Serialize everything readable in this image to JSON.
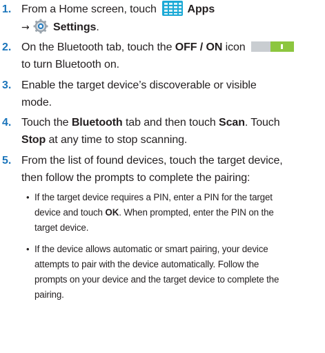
{
  "steps": [
    {
      "number": "1.",
      "line1": {
        "prefix": "From a Home screen, touch ",
        "bold1": "Apps"
      },
      "line2": {
        "arrow": "→",
        "bold1": "Settings",
        "suffix": "."
      }
    },
    {
      "number": "2.",
      "line1": {
        "prefix": "On the Bluetooth tab, touch the ",
        "bold1": "OFF / ON",
        "suffix": " icon"
      },
      "line2": {
        "text": "to turn Bluetooth on."
      }
    },
    {
      "number": "3.",
      "line1": {
        "text": "Enable the target device’s discoverable or visible"
      },
      "line2": {
        "text": "mode."
      }
    },
    {
      "number": "4.",
      "line1": {
        "prefix": "Touch the ",
        "bold1": "Bluetooth",
        "middle": " tab and then touch ",
        "bold2": "Scan",
        "suffix": ". Touch"
      },
      "line2": {
        "bold1": "Stop",
        "suffix": " at any time to stop scanning."
      }
    },
    {
      "number": "5.",
      "line1": {
        "text": "From the list of found devices, touch the target device,"
      },
      "line2": {
        "text": "then follow the prompts to complete the pairing:"
      }
    }
  ],
  "bullets": [
    {
      "dot": "•",
      "line1": "If the target device requires a PIN, enter a PIN for the target",
      "line2_prefix": "device and touch ",
      "line2_bold": "OK",
      "line2_suffix": ". When prompted, enter the PIN on the",
      "line3": "target device."
    },
    {
      "dot": "•",
      "line1": "If the device allows automatic or smart pairing, your device",
      "line2": "attempts to pair with the device automatically. Follow the",
      "line3": "prompts on your device and the target device to complete the",
      "line4": "pairing."
    }
  ],
  "icons": {
    "apps": "apps-grid-icon",
    "settings": "settings-gear-icon",
    "toggle": "off-on-toggle-icon"
  },
  "colors": {
    "step_number": "#1b75bb",
    "apps_icon": "#1ba9d6",
    "toggle_on": "#8cc63f",
    "text": "#231f20"
  }
}
